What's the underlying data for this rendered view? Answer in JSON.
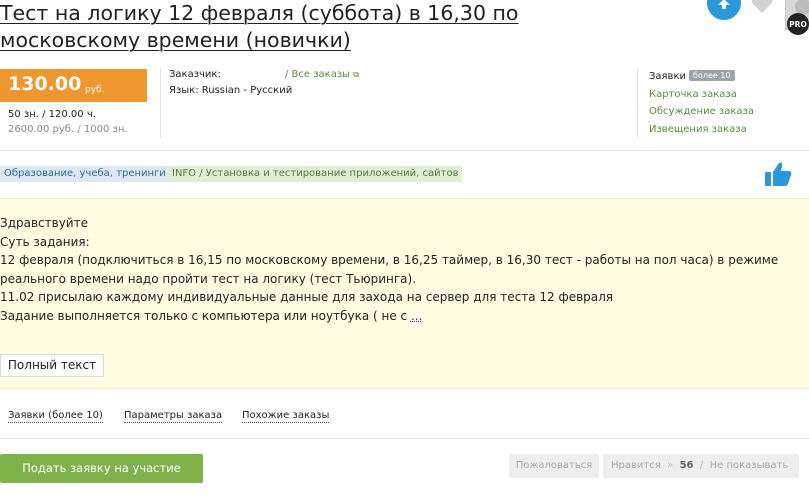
{
  "order": {
    "title": "Тест на логику 12 февраля (суббота) в 16,30 по московскому времени (новички)"
  },
  "header_icons": {
    "up": "arrow-up-icon",
    "favorite": "heart-icon",
    "avatar": "user-avatar",
    "pro_badge": "PRO"
  },
  "price": {
    "amount": "130.00",
    "currency": "руб.",
    "rate": "50 зн. / 120.00 ч.",
    "alt_rate": "2600.00 руб. / 1000 зн."
  },
  "meta": {
    "customer_label": "Заказчик:",
    "all_orders": "/ Все заказы",
    "lang_line": "Язык: Russian - Русский"
  },
  "sidebar": {
    "bids_label": "Заявки",
    "bids_badge": "более 10",
    "card": "Карточка заказа",
    "discussion": "Обсуждение заказа",
    "notifications": "Извещения заказа"
  },
  "tags": [
    "Образование, учеба, тренинги",
    "INFO / Установка и тестирование приложений, сайтов"
  ],
  "description": {
    "lines": [
      "Здравствуйте",
      "Суть задания:",
      "12 февраля (подключиться в 16,15 по московскому времени, в 16,25 таймер, в 16,30 тест - работы на пол часа) в режиме реального времени надо пройти тест на логику (тест Тьюринга).",
      "",
      "11.02 присылаю каждому индивидуальные данные для захода на сервер для теста 12 февраля"
    ],
    "last_line": "Задание выполняется только с компьютера или ноутбука ( не с ",
    "more": "...",
    "full_text_button": "Полный текст"
  },
  "tabs": {
    "bids": "Заявки (более 10)",
    "params": "Параметры заказа",
    "similar": "Похожие заказы"
  },
  "actions": {
    "apply": "Подать заявку на участие",
    "complain": "Пожаловаться",
    "like": "Нравится",
    "likes_count": "56",
    "hide": "Не показывать"
  },
  "colors": {
    "price_bg": "#f0962e",
    "link_green": "#5a8d3c",
    "apply_bg": "#7fb24b",
    "desc_bg": "#fefde2",
    "up_icon": "#2a98d9",
    "thumb_icon": "#2a98d9"
  }
}
